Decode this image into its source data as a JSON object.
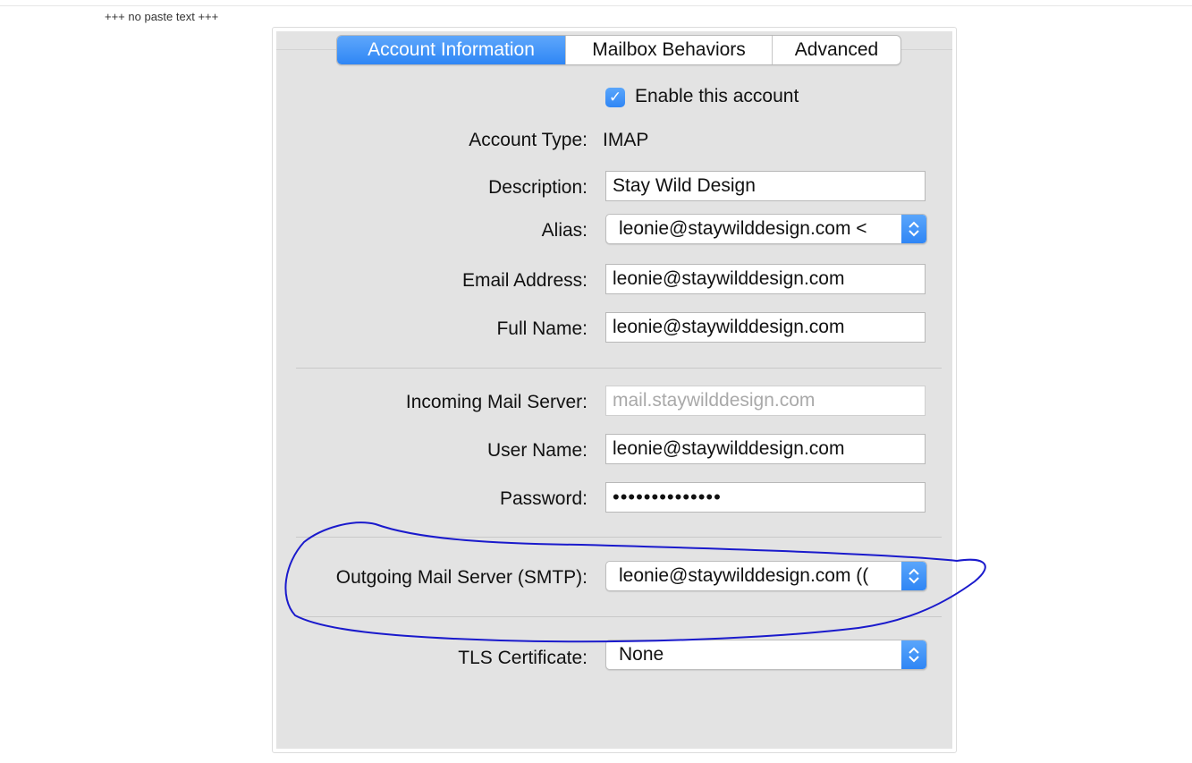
{
  "header_note": "+++ no paste text +++",
  "tabs": [
    {
      "label": "Account Information",
      "active": true
    },
    {
      "label": "Mailbox Behaviors",
      "active": false
    },
    {
      "label": "Advanced",
      "active": false
    }
  ],
  "enable_account": {
    "label": "Enable this account",
    "checked": true
  },
  "account_type": {
    "label": "Account Type:",
    "value": "IMAP"
  },
  "description": {
    "label": "Description:",
    "value": "Stay Wild Design"
  },
  "alias": {
    "label": "Alias:",
    "value": "leonie@staywilddesign.com <"
  },
  "email_address": {
    "label": "Email Address:",
    "value": "leonie@staywilddesign.com"
  },
  "full_name": {
    "label": "Full Name:",
    "value": "leonie@staywilddesign.com"
  },
  "incoming_server": {
    "label": "Incoming Mail Server:",
    "value": "mail.staywilddesign.com"
  },
  "user_name": {
    "label": "User Name:",
    "value": "leonie@staywilddesign.com"
  },
  "password": {
    "label": "Password:",
    "value": "••••••••••••••"
  },
  "outgoing_server": {
    "label": "Outgoing Mail Server (SMTP):",
    "value": "leonie@staywilddesign.com (("
  },
  "tls_certificate": {
    "label": "TLS Certificate:",
    "value": "None"
  },
  "colors": {
    "accent": "#2f86f5",
    "panel_bg": "#e3e3e3",
    "annotation_ink": "#1a1acc"
  }
}
